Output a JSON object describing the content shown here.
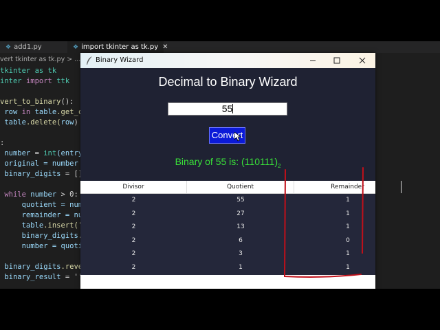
{
  "editor": {
    "tabs": [
      {
        "label": "add1.py",
        "active": false
      },
      {
        "label": "import tkinter as tk.py",
        "active": true
      }
    ],
    "breadcrumb": "vert tkinter as tk.py > ...",
    "code_lines": [
      [
        [
          "tkinter as tk",
          "c"
        ]
      ],
      [
        [
          "inter ",
          "c"
        ],
        [
          "import ",
          "k"
        ],
        [
          "ttk",
          "c"
        ]
      ],
      [
        [
          "",
          ""
        ]
      ],
      [
        [
          "vert_to_binary",
          "f"
        ],
        [
          "():",
          ""
        ]
      ],
      [
        [
          " row ",
          "v"
        ],
        [
          "in ",
          "k"
        ],
        [
          "table",
          "v"
        ],
        [
          ".get_ch",
          "f"
        ]
      ],
      [
        [
          " table",
          "v"
        ],
        [
          ".delete(",
          "f"
        ],
        [
          "row",
          "v"
        ],
        [
          ")",
          ""
        ]
      ],
      [
        [
          "",
          ""
        ]
      ],
      [
        [
          ":",
          ""
        ]
      ],
      [
        [
          " number ",
          "v"
        ],
        [
          "= ",
          ""
        ],
        [
          "int",
          "c"
        ],
        [
          "(entry.",
          "v"
        ]
      ],
      [
        [
          " original ",
          "v"
        ],
        [
          "= number",
          "v"
        ]
      ],
      [
        [
          " binary_digits ",
          "v"
        ],
        [
          "= []",
          ""
        ]
      ],
      [
        [
          "",
          ""
        ]
      ],
      [
        [
          " ",
          ""
        ],
        [
          "while ",
          "k"
        ],
        [
          "number ",
          "v"
        ],
        [
          "> 0:",
          ""
        ]
      ],
      [
        [
          "     quotient ",
          "v"
        ],
        [
          "= numb",
          "v"
        ]
      ],
      [
        [
          "     remainder ",
          "v"
        ],
        [
          "= num",
          "v"
        ]
      ],
      [
        [
          "     table",
          "v"
        ],
        [
          ".insert('",
          "f"
        ]
      ],
      [
        [
          "     binary_digits",
          "v"
        ],
        [
          ".a",
          "f"
        ]
      ],
      [
        [
          "     number ",
          "v"
        ],
        [
          "= quotie",
          "v"
        ]
      ],
      [
        [
          "",
          ""
        ]
      ],
      [
        [
          " binary_digits",
          "v"
        ],
        [
          ".rever",
          "f"
        ]
      ],
      [
        [
          " binary_result ",
          "v"
        ],
        [
          "= ''.",
          ""
        ]
      ]
    ]
  },
  "window": {
    "title": "Binary Wizard",
    "heading": "Decimal to Binary Wizard",
    "input_value": "55",
    "convert_label": "Convert",
    "result_text": "Binary of 55 is: (110111)",
    "result_subscript": "2",
    "table": {
      "columns": [
        "Divisor",
        "Quotient",
        "Remainder"
      ],
      "rows": [
        [
          "2",
          "55",
          "1"
        ],
        [
          "2",
          "27",
          "1"
        ],
        [
          "2",
          "13",
          "1"
        ],
        [
          "2",
          "6",
          "0"
        ],
        [
          "2",
          "3",
          "1"
        ],
        [
          "2",
          "1",
          "1"
        ]
      ]
    }
  },
  "colors": {
    "result_green": "#39e039",
    "button_blue": "#0b1ad8",
    "window_bg": "#1f2233",
    "annotation_red": "#c0101a"
  }
}
